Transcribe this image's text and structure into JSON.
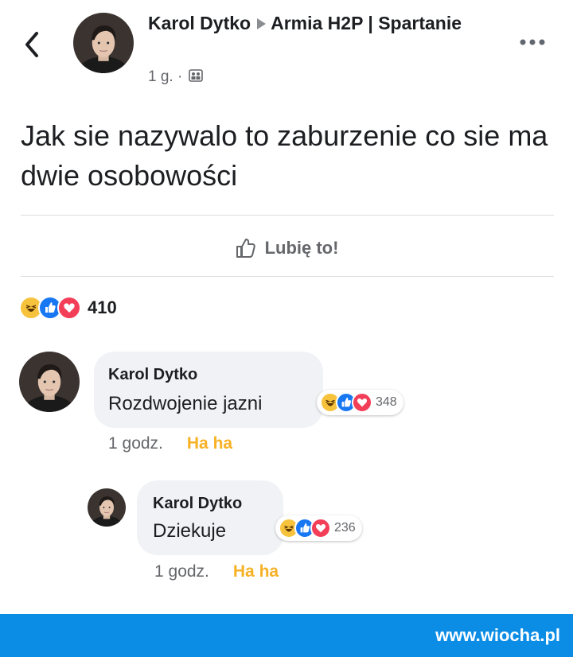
{
  "header": {
    "back_icon": "chevron-left-icon",
    "author": "Karol Dytko",
    "group": "Armia H2P | Spartanie",
    "time": "1 g. ·",
    "audience_icon": "group-audience-icon",
    "more_icon": "more-dots-icon"
  },
  "post": {
    "text": "Jak sie nazywalo to zaburzenie co sie ma dwie osobowości"
  },
  "actions": {
    "like_label": "Lubię to!",
    "like_icon": "thumbs-up-outline-icon"
  },
  "reactions": {
    "types": [
      "haha",
      "like",
      "love"
    ],
    "count": "410"
  },
  "comments": [
    {
      "author": "Karol Dytko",
      "text": "Rozdwojenie jazni",
      "reaction_count": "348",
      "time": "1 godz.",
      "reaction_label": "Ha ha"
    },
    {
      "author": "Karol Dytko",
      "text": "Dziekuje",
      "reaction_count": "236",
      "time": "1 godz.",
      "reaction_label": "Ha ha"
    }
  ],
  "watermark": "www.wiocha.pl",
  "colors": {
    "like_blue": "#1877f2",
    "haha_yellow": "#f7c33d",
    "love_red": "#f33e58",
    "footer_blue": "#0b8de6"
  }
}
